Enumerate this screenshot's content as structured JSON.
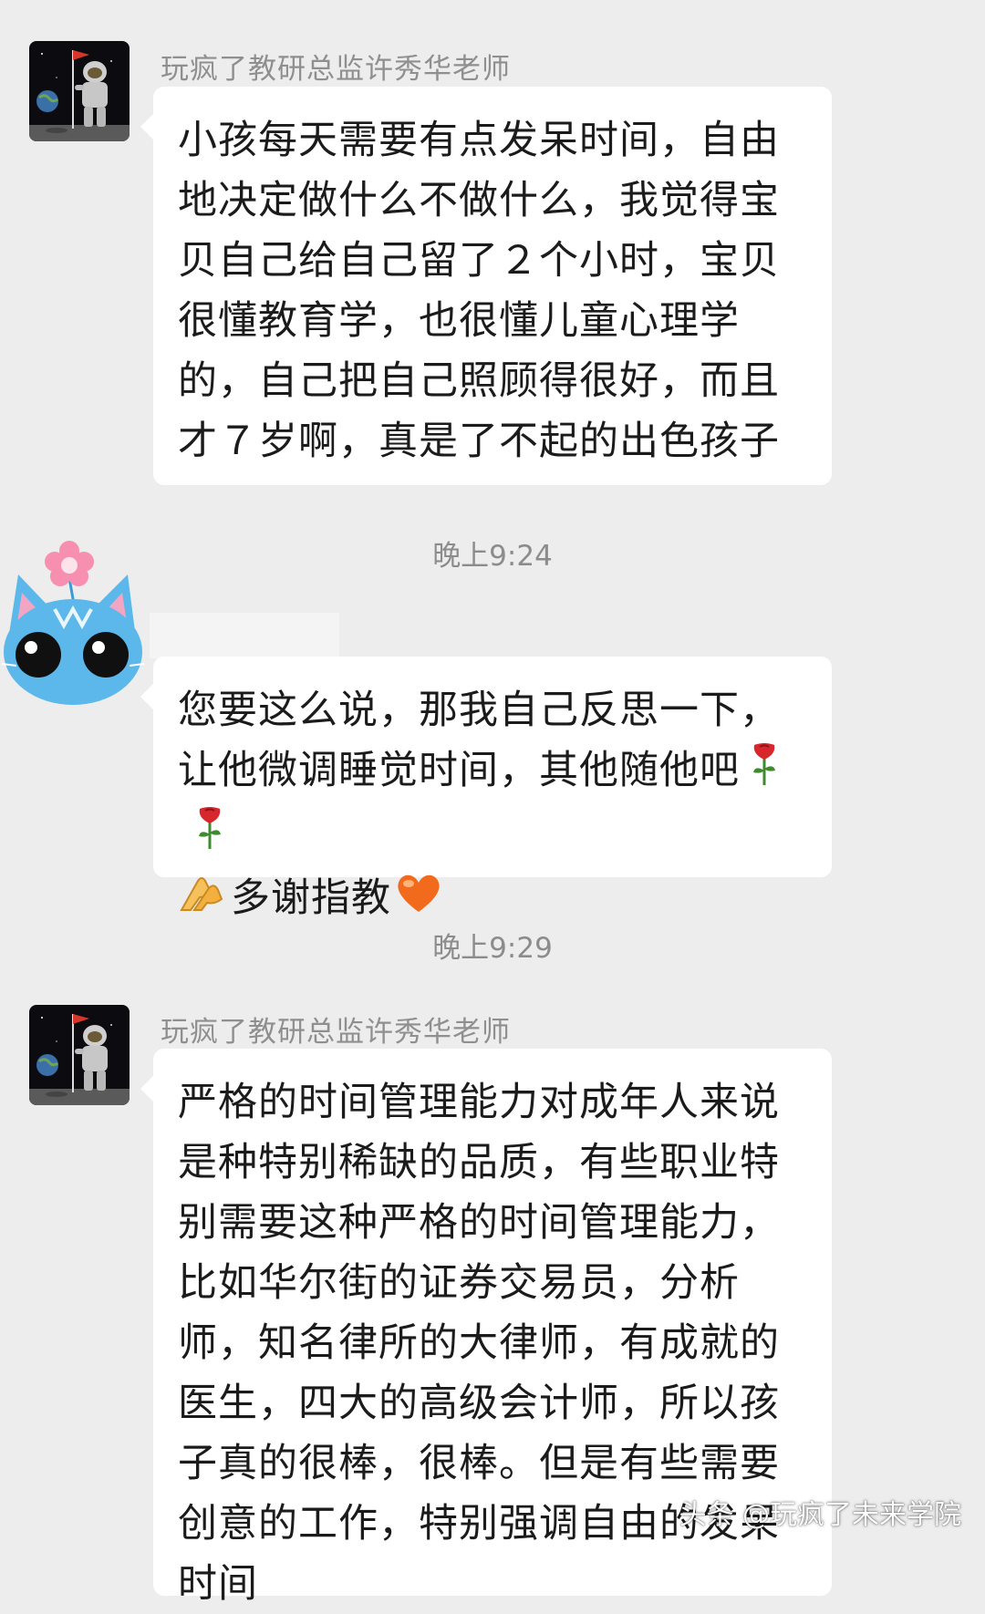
{
  "messages": [
    {
      "sender": "玩疯了教研总监许秀华老师",
      "text": "小孩每天需要有点发呆时间，自由地决定做什么不做什么，我觉得宝贝自己给自己留了２个小时，宝贝很懂教育学，也很懂儿童心理学的，自己把自己照顾得很好，而且才７岁啊，真是了不起的出色孩子"
    },
    {
      "timestamp": "晚上9:24"
    },
    {
      "sender": "",
      "text_part1": "您要这么说，那我自己反思一下，让他微调睡觉时间，其他随他吧",
      "text_part2": "多谢指教",
      "emoji_1": "rose-icon",
      "emoji_2": "rose-icon",
      "emoji_3": "praying-hands-icon",
      "emoji_4": "orange-heart-icon"
    },
    {
      "timestamp": "晚上9:29"
    },
    {
      "sender": "玩疯了教研总监许秀华老师",
      "text": "严格的时间管理能力对成年人来说是种特别稀缺的品质，有些职业特别需要这种严格的时间管理能力，比如华尔街的证券交易员，分析师，知名律所的大律师，有成就的 医生，四大的高级会计师，所以孩子真的很棒，很棒。但是有些需要创意的工作，特别强调自由的发呆时间"
    }
  ],
  "watermark": "头条 @玩疯了未来学院",
  "colors": {
    "background": "#ededed",
    "bubble": "#ffffff",
    "text": "#1b1b1b",
    "meta_text": "#8c8c8c"
  }
}
